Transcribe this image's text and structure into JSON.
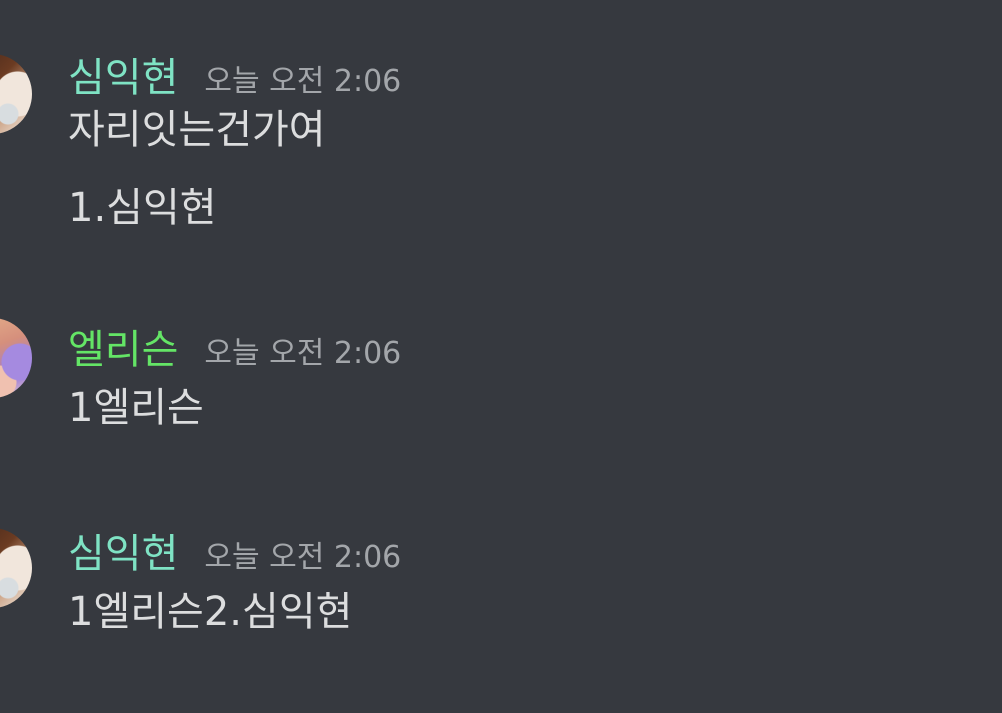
{
  "messages": [
    {
      "author": "심익현",
      "timestamp": "오늘 오전 2:06",
      "avatar": "avatar-simikhyeon",
      "color": "#7fe3c4",
      "lines": [
        "자리잇는건가여",
        "1.심익현"
      ]
    },
    {
      "author": "엘리슨",
      "timestamp": "오늘 오전 2:06",
      "avatar": "avatar-ellison",
      "color": "#64e566",
      "lines": [
        "1엘리슨"
      ]
    },
    {
      "author": "심익현",
      "timestamp": "오늘 오전 2:06",
      "avatar": "avatar-simikhyeon",
      "color": "#7fe3c4",
      "lines": [
        "1엘리슨2.심익현"
      ]
    }
  ]
}
